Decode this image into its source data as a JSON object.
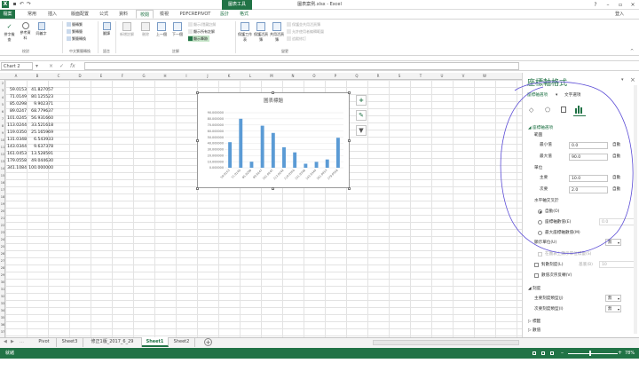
{
  "window": {
    "title": "圖表案例.xlsx - Excel",
    "context_tab_group": "圖表工具",
    "user": "登入"
  },
  "ribbon_tabs": [
    "檔案",
    "常用",
    "插入",
    "版面配置",
    "公式",
    "資料",
    "校閱",
    "檢視",
    "PDFCREPIVOT",
    "設計",
    "格式"
  ],
  "ribbon": {
    "proofing": {
      "group": "校對",
      "spell": "拼字檢查",
      "research": "參考資料",
      "thesaurus": "同義字"
    },
    "chinese": {
      "group": "中文繁簡轉換",
      "to_trad": "簡轉繁",
      "to_simp": "繁轉簡",
      "convert": "繁簡轉換"
    },
    "language": {
      "group": "語言",
      "translate": "翻譯"
    },
    "comments": {
      "group": "註解",
      "new": "新增註解",
      "delete": "刪除",
      "prev": "上一個",
      "next": "下一個",
      "show_hide": "顯示/隱藏註解",
      "show_all": "顯示所有註解",
      "show_ink": "顯示筆跡"
    },
    "changes": {
      "group": "變更",
      "protect_sheet": "保護工作表",
      "protect_workbook": "保護活頁簿",
      "share_workbook": "共用活頁簿",
      "protect_share": "保護並共用活頁簿",
      "allow_edit": "允許使用者編輯範圍",
      "track": "追蹤修訂"
    }
  },
  "formula_bar": {
    "name_box": "Chart 2",
    "fx": "fx",
    "value": ""
  },
  "columns": [
    "A",
    "B",
    "C",
    "D",
    "E",
    "F",
    "G",
    "H",
    "I",
    "J",
    "K",
    "L",
    "M",
    "N",
    "O",
    "P",
    "Q",
    "R",
    "S",
    "T",
    "U",
    "V",
    "W"
  ],
  "rows": [
    "2",
    "3",
    "4",
    "5",
    "6",
    "7",
    "8",
    "9",
    "10",
    "11",
    "12",
    "13",
    "14",
    "15",
    "16",
    "17",
    "18",
    "19",
    "20",
    "21",
    "22",
    "23",
    "24",
    "25",
    "26",
    "27",
    "28",
    "29",
    "30",
    "31",
    "32",
    "33",
    "34",
    "35",
    "36",
    "37"
  ],
  "cells": [
    {
      "a": "59.0153",
      "b": "41.827057"
    },
    {
      "a": "71.0149",
      "b": "80.125523"
    },
    {
      "a": "85.0298",
      "b": "9.902371"
    },
    {
      "a": "89.0247",
      "b": "68.779637"
    },
    {
      "a": "101.0245",
      "b": "56.931660"
    },
    {
      "a": "113.0244",
      "b": "33.521618"
    },
    {
      "a": "119.0350",
      "b": "25.165969"
    },
    {
      "a": "131.0348",
      "b": "6.543933"
    },
    {
      "a": "143.0344",
      "b": "9.637378"
    },
    {
      "a": "161.0453",
      "b": "13.528591"
    },
    {
      "a": "179.0558",
      "b": "49.044630"
    },
    {
      "a": "341.1084",
      "b": "100.000000"
    }
  ],
  "chart_data": {
    "type": "bar",
    "title": "圖表標題",
    "categories": [
      "59.0153",
      "71.0149",
      "85.0298",
      "89.0247",
      "101.0245",
      "113.0244",
      "119.0350",
      "131.0348",
      "143.0344",
      "161.0453",
      "179.0558"
    ],
    "values": [
      41.827057,
      80.125523,
      9.902371,
      68.779637,
      56.93166,
      33.521618,
      25.165969,
      6.543933,
      9.637378,
      13.528591,
      49.04463
    ],
    "ylim": [
      0,
      90
    ],
    "yticks": [
      "0.000000",
      "10.000000",
      "20.000000",
      "30.000000",
      "40.000000",
      "50.000000",
      "60.000000",
      "70.000000",
      "80.000000",
      "90.000000"
    ],
    "major_unit": 10,
    "grid": true,
    "bar_color": "#5b9bd5"
  },
  "chart_buttons": [
    "+",
    "brush-icon",
    "filter-icon"
  ],
  "pane": {
    "title": "座標軸格式",
    "opt_axis": "座標軸選項",
    "opt_text": "文字選項",
    "section_axis": "座標軸選項",
    "bounds": "範圍",
    "min_label": "最小值",
    "min_value": "0.0",
    "min_auto": "自動",
    "max_label": "最大值",
    "max_value": "90.0",
    "max_auto": "自動",
    "units": "單位",
    "major_label": "主要",
    "major_value": "10.0",
    "major_auto": "自動",
    "minor_label": "次要",
    "minor_value": "2.0",
    "minor_auto": "自動",
    "cross": "水平軸交叉於",
    "cross_auto": "自動(O)",
    "cross_axis_value": "座標軸數值(E)",
    "cross_axis_input": "0.0",
    "cross_max": "最大座標軸數值(M)",
    "display_units": "顯示單位(U)",
    "display_units_value": "無",
    "show_units_label": "在圖表上顯示單位標籤(S)",
    "log_scale": "對數刻度(L)",
    "log_base_label": "基底(B)",
    "log_base_value": "10",
    "reverse": "數值次序反轉(V)",
    "tick_section": "刻度",
    "major_tick": "主要刻度類型(J)",
    "major_tick_value": "無",
    "minor_tick": "次要刻度類型(I)",
    "minor_tick_value": "無",
    "labels": "標籤",
    "number": "數值"
  },
  "sheet_tabs": [
    "Pivot",
    "Sheet3",
    "修正1版_2017_6_29",
    "Sheet1",
    "Sheet2"
  ],
  "active_sheet": "Sheet1",
  "status": {
    "ready": "就緒",
    "zoom": "78%"
  },
  "colors": {
    "excel_green": "#217346",
    "annotation": "#5b4cd6"
  }
}
